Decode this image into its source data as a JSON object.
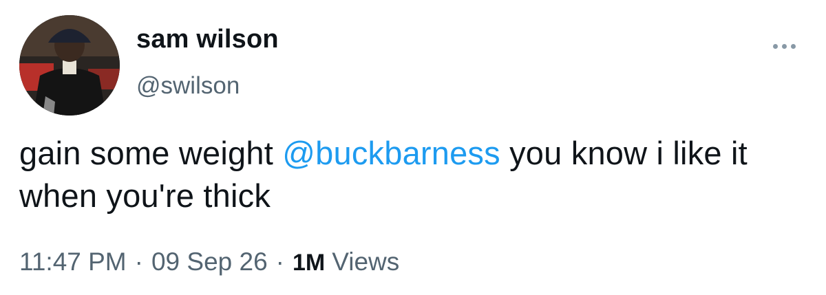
{
  "tweet": {
    "author": {
      "display_name": "sam wilson",
      "handle": "@swilson"
    },
    "text": {
      "before_mention": "gain some weight ",
      "mention": "@buckbarness",
      "after_mention": " you know i like it when you're thick"
    },
    "meta": {
      "time": "11:47 PM",
      "separator": "·",
      "date": "09 Sep 26",
      "views_count": "1M",
      "views_label": "Views"
    }
  },
  "colors": {
    "text_primary": "#0f1419",
    "text_secondary": "#536471",
    "link": "#1d9bf0"
  },
  "icons": {
    "more": "more-horizontal-icon"
  }
}
